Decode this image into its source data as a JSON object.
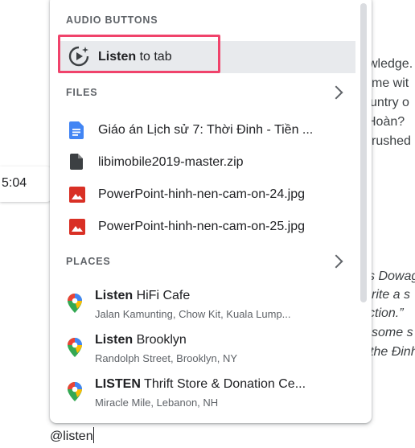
{
  "background": {
    "right_lines": [
      "wledge.",
      "me wit",
      "untry o",
      " Hoàn?",
      "rushed"
    ],
    "right_italic_lines": [
      "s Dowag",
      "rite a s",
      "ction.”",
      "some s",
      "the Đinh"
    ],
    "time_chip": "5:04"
  },
  "editor": {
    "mention_text": "@listen"
  },
  "popup": {
    "audio_section": "AUDIO BUTTONS",
    "listen_bold": "Listen",
    "listen_rest": " to tab",
    "files_section": "FILES",
    "files": [
      {
        "name": "Giáo án Lịch sử 7: Thời Đinh - Tiền ...",
        "icon": "google-docs-icon"
      },
      {
        "name": "libimobile2019-master.zip",
        "icon": "file-icon"
      },
      {
        "name": "PowerPoint-hinh-nen-cam-on-24.jpg",
        "icon": "image-icon"
      },
      {
        "name": "PowerPoint-hinh-nen-cam-on-25.jpg",
        "icon": "image-icon"
      }
    ],
    "places_section": "PLACES",
    "places": [
      {
        "bold": "Listen",
        "rest": " HiFi Cafe",
        "address": "Jalan Kamunting, Chow Kit, Kuala Lump..."
      },
      {
        "bold": "Listen",
        "rest": " Brooklyn",
        "address": "Randolph Street, Brooklyn, NY"
      },
      {
        "bold": "LISTEN",
        "rest": " Thrift Store & Donation Ce...",
        "address": "Miracle Mile, Lebanon, NH"
      }
    ],
    "colors": {
      "highlight": "#f0436b",
      "docs_blue": "#4285f4",
      "image_red": "#d93025"
    }
  }
}
